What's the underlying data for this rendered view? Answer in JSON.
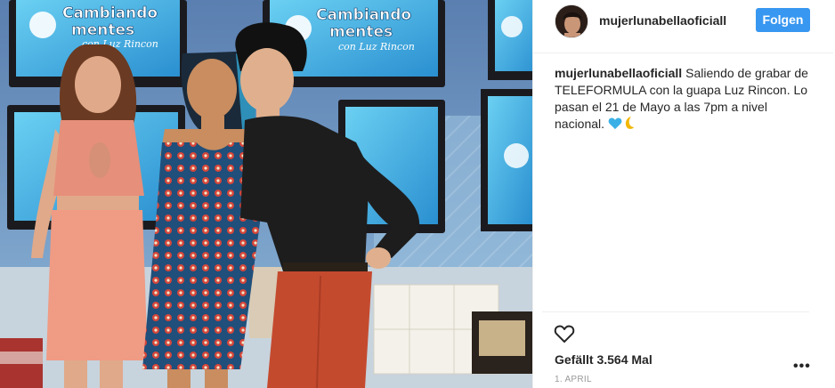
{
  "post": {
    "username": "mujerlunabellaoficiall",
    "follow_label": "Folgen",
    "caption_user": "mujerlunabellaoficiall",
    "caption_text": "Saliendo de grabar de TELEFORMULA con la guapa Luz Rincon. Lo pasan el 21 de Mayo a las 7pm a nivel nacional.",
    "likes": "Gefällt 3.564 Mal",
    "date": "1. APRIL",
    "more_label": "•••"
  },
  "photo": {
    "tv_logo_line1": "Cambiando",
    "tv_logo_line2": "mentes",
    "tv_logo_line3": "con Luz Rincon"
  },
  "icons": {
    "caption_emoji_1": "blue-heart-icon",
    "caption_emoji_2": "crescent-moon-icon",
    "like": "heart-outline-icon",
    "more": "ellipsis-icon"
  },
  "colors": {
    "follow_button": "#3897f0",
    "text": "#262626",
    "muted": "#999999",
    "border": "#efefef"
  }
}
